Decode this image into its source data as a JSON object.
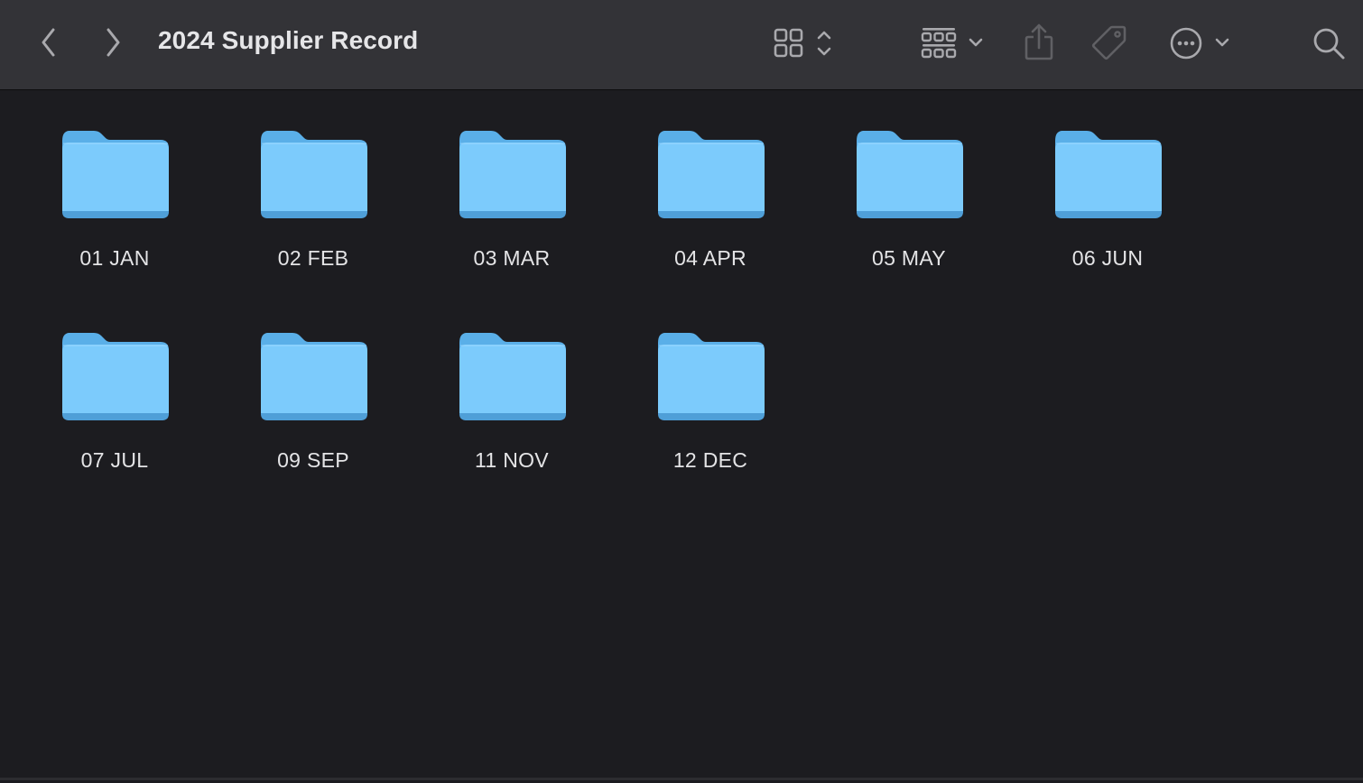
{
  "window": {
    "title": "2024 Supplier Record"
  },
  "toolbar": {
    "icons": {
      "back": "chevron-left-icon",
      "forward": "chevron-right-icon",
      "view_mode": "icon-grid-view-icon",
      "group": "group-by-icon",
      "share": "share-icon",
      "tag": "tag-icon",
      "more": "more-actions-icon",
      "search": "search-icon"
    }
  },
  "folders": [
    {
      "name": "01 JAN"
    },
    {
      "name": "02 FEB"
    },
    {
      "name": "03 MAR"
    },
    {
      "name": "04 APR"
    },
    {
      "name": "05 MAY"
    },
    {
      "name": "06 JUN"
    },
    {
      "name": "07 JUL"
    },
    {
      "name": "09 SEP"
    },
    {
      "name": "11 NOV"
    },
    {
      "name": "12 DEC"
    }
  ],
  "colors": {
    "toolbar_bg": "#333337",
    "content_bg": "#1c1c20",
    "folder_front": "#7ccbfc",
    "folder_back": "#5aafe8",
    "folder_edge": "#4f9fd8",
    "label_text": "#e4e4e6",
    "icon_color": "#a9a9ad",
    "icon_disabled": "#606064"
  }
}
